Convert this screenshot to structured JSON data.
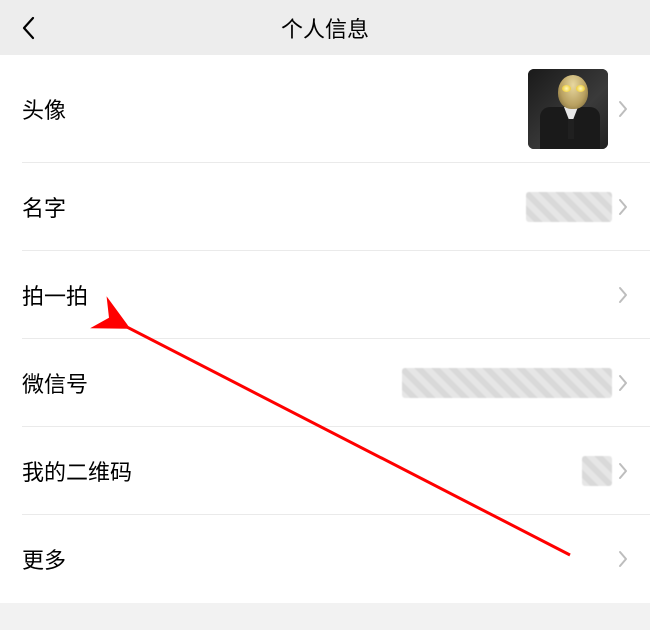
{
  "header": {
    "title": "个人信息"
  },
  "rows": {
    "avatar": {
      "label": "头像"
    },
    "name": {
      "label": "名字"
    },
    "pat": {
      "label": "拍一拍"
    },
    "wechat": {
      "label": "微信号"
    },
    "qr": {
      "label": "我的二维码"
    },
    "more": {
      "label": "更多"
    }
  },
  "annotation": {
    "arrow_color": "#ff0000"
  }
}
